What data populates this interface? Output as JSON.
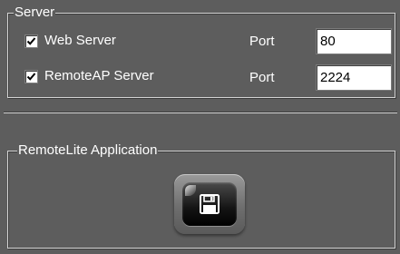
{
  "server_group": {
    "title": "Server",
    "web_server": {
      "label": "Web Server",
      "checked": true,
      "port_label": "Port",
      "port": "80"
    },
    "remote_ap_server": {
      "label": "RemoteAP Server",
      "checked": true,
      "port_label": "Port",
      "port": "2224"
    }
  },
  "app_group": {
    "title": "RemoteLite Application",
    "save_button_icon": "floppy-disk-icon"
  }
}
